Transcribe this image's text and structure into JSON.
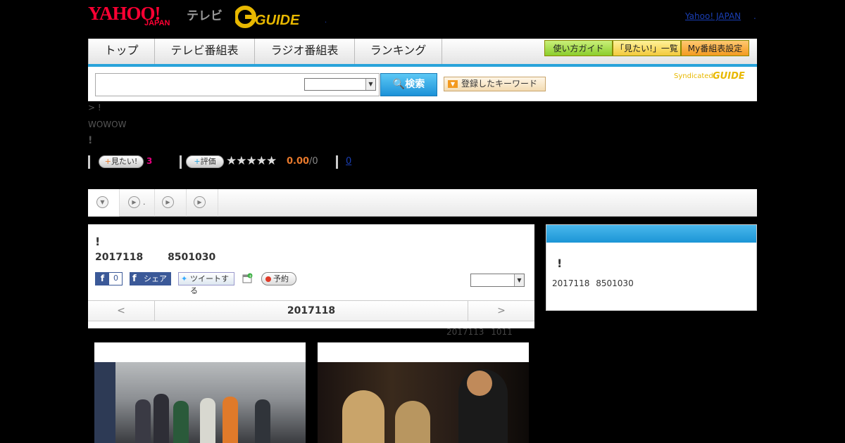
{
  "header": {
    "yahoo_logo": "YAHOO!",
    "yahoo_japan": "JAPAN",
    "tv": "テレビ",
    "gguide": "GUIDE",
    "yahoo_japan_link": "Yahoo! JAPAN",
    "dot1": ".",
    "dot2": "."
  },
  "nav": {
    "tabs": [
      "トップ",
      "テレビ番組表",
      "ラジオ番組表",
      "ランキング"
    ],
    "buttons": [
      "使い方ガイド",
      "「見たい!」一覧",
      "My番組表設定"
    ]
  },
  "search": {
    "input_value": "",
    "select_value": "",
    "button_label": "検索",
    "keyword_button": "登録したキーワード",
    "syndicated": "Syndicated",
    "syndicated_brand": "GUIDE"
  },
  "program": {
    "breadcrumb": "> !",
    "channel": "WOWOW",
    "title_mark": "!",
    "mitai_label": "見たい!",
    "mitai_count": "3",
    "hyouka_label": "評価",
    "stars": "★★★★★",
    "rating": "0.00",
    "rating_den": "/0",
    "review_count": "0"
  },
  "tabs": [
    {
      "label": ""
    },
    {
      "label": "."
    },
    {
      "label": ""
    },
    {
      "label": ""
    }
  ],
  "main": {
    "title": "!",
    "date_time": "2017118 8501030",
    "fb_like_count": "0",
    "fb_share": "シェア",
    "tweet": "ツイートする",
    "reserve": "予約",
    "select_value": "",
    "prev": "<",
    "day": "2017118",
    "next": ">",
    "updated": "2017113 1011"
  },
  "side": {
    "title": "!",
    "date_time": "2017118 8501030"
  },
  "colors": {
    "accent_blue": "#29a3da",
    "yahoo_red": "#ff0033",
    "gguide_yellow": "#e8b800",
    "facebook": "#3b5998"
  }
}
